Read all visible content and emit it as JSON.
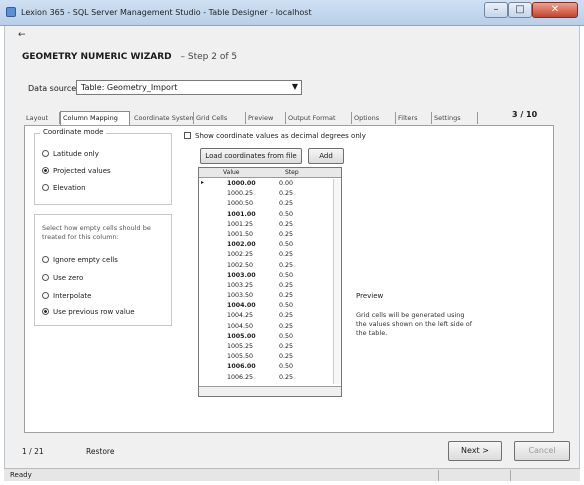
{
  "window": {
    "title": "Lexion 365 - SQL Server Management Studio - Table Designer - localhost",
    "minimize_glyph": "–",
    "maximize_glyph": "□",
    "close_glyph": "✕"
  },
  "nav": {
    "back_glyph": "←",
    "breadcrumb_main": "GEOMETRY NUMERIC WIZARD",
    "breadcrumb_rest": "– Step 2 of 5"
  },
  "dialog": {
    "label": "Data source:",
    "select_value": "Table: Geometry_Import",
    "caret": "▼"
  },
  "tabs": [
    {
      "label": "Layout"
    },
    {
      "label": "Column Mapping"
    },
    {
      "label": "Coordinate System"
    },
    {
      "label": "Grid Cells"
    },
    {
      "label": "Preview"
    },
    {
      "label": "Output Format"
    },
    {
      "label": "Options"
    },
    {
      "label": "Filters"
    },
    {
      "label": "Settings"
    }
  ],
  "tabs_counter": "3 / 10",
  "left_panel": {
    "group1_title": "Coordinate mode",
    "options1": [
      {
        "label": "Latitude only",
        "on": false
      },
      {
        "label": "Projected values",
        "on": true
      },
      {
        "label": "Elevation",
        "on": false
      }
    ],
    "group2_text": "Select how empty cells should be treated for this column:",
    "options2": [
      {
        "label": "Ignore empty cells",
        "on": false
      },
      {
        "label": "Use zero",
        "on": false
      },
      {
        "label": "Interpolate",
        "on": false
      },
      {
        "label": "Use previous row value",
        "on": true
      }
    ]
  },
  "grid": {
    "title": "Show coordinate values as decimal degrees only",
    "load_button": "Load coordinates from file",
    "add_button": "Add",
    "header": [
      "Value",
      "Step"
    ],
    "rows": [
      {
        "c1": "1000.00",
        "c2": "0.00",
        "ind": "▸",
        "emph": true
      },
      {
        "c1": "1000.25",
        "c2": "0.25",
        "ind": "",
        "emph": false
      },
      {
        "c1": "1000.50",
        "c2": "0.25",
        "ind": "",
        "emph": false
      },
      {
        "c1": "1001.00",
        "c2": "0.50",
        "ind": "",
        "emph": true
      },
      {
        "c1": "1001.25",
        "c2": "0.25",
        "ind": "",
        "emph": false
      },
      {
        "c1": "1001.50",
        "c2": "0.25",
        "ind": "",
        "emph": false
      },
      {
        "c1": "1002.00",
        "c2": "0.50",
        "ind": "",
        "emph": true
      },
      {
        "c1": "1002.25",
        "c2": "0.25",
        "ind": "",
        "emph": false
      },
      {
        "c1": "1002.50",
        "c2": "0.25",
        "ind": "",
        "emph": false
      },
      {
        "c1": "1003.00",
        "c2": "0.50",
        "ind": "",
        "emph": true
      },
      {
        "c1": "1003.25",
        "c2": "0.25",
        "ind": "",
        "emph": false
      },
      {
        "c1": "1003.50",
        "c2": "0.25",
        "ind": "",
        "emph": false
      },
      {
        "c1": "1004.00",
        "c2": "0.50",
        "ind": "",
        "emph": true
      },
      {
        "c1": "1004.25",
        "c2": "0.25",
        "ind": "",
        "emph": false
      },
      {
        "c1": "1004.50",
        "c2": "0.25",
        "ind": "",
        "emph": false
      },
      {
        "c1": "1005.00",
        "c2": "0.50",
        "ind": "",
        "emph": true
      },
      {
        "c1": "1005.25",
        "c2": "0.25",
        "ind": "",
        "emph": false
      },
      {
        "c1": "1005.50",
        "c2": "0.25",
        "ind": "",
        "emph": false
      },
      {
        "c1": "1006.00",
        "c2": "0.50",
        "ind": "",
        "emph": true
      },
      {
        "c1": "1006.25",
        "c2": "0.25",
        "ind": "",
        "emph": false
      }
    ]
  },
  "info": {
    "title": "Preview",
    "text": "Grid cells will be generated using the values shown on the left side of the table."
  },
  "footer": {
    "left": "1 / 21",
    "link": "Restore",
    "next": "Next >",
    "cancel": "Cancel"
  },
  "status": {
    "text": "Ready"
  }
}
